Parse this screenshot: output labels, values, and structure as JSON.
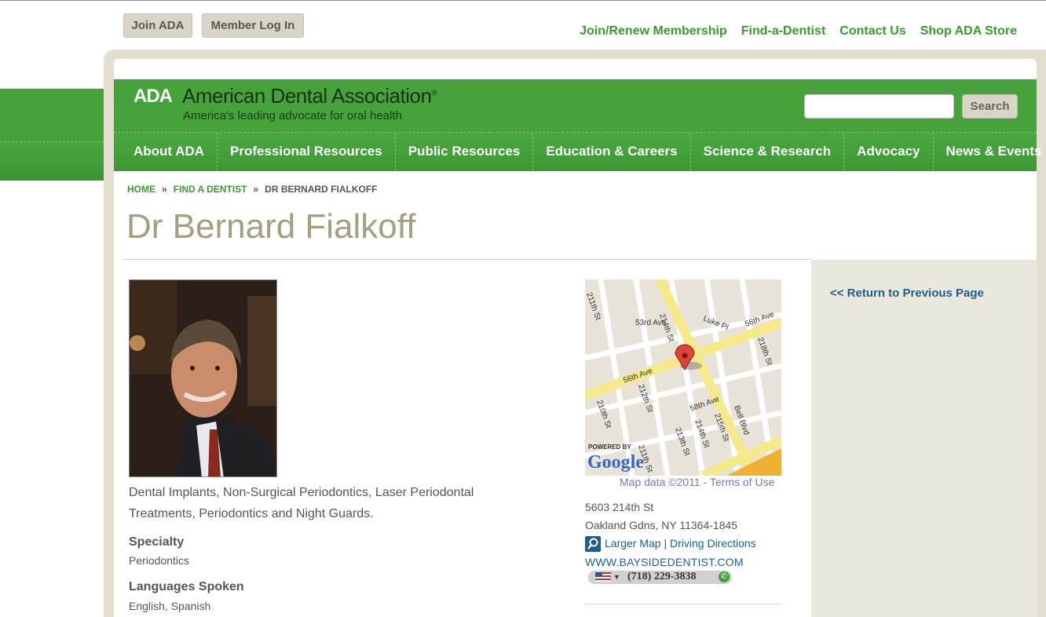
{
  "utility": {
    "join_label": "Join ADA",
    "login_label": "Member Log In"
  },
  "top_links": [
    "Join/Renew Membership",
    "Find-a-Dentist",
    "Contact Us",
    "Shop ADA Store"
  ],
  "header": {
    "logo_abbr": "ADA",
    "org_name": "American Dental Association",
    "org_mark": "®",
    "tagline": "America's leading advocate for oral health",
    "search_placeholder": "",
    "search_label": "Search"
  },
  "nav": [
    "About ADA",
    "Professional Resources",
    "Public Resources",
    "Education & Careers",
    "Science & Research",
    "Advocacy",
    "News & Events"
  ],
  "breadcrumb": {
    "home": "HOME",
    "sep": "»",
    "find": "FIND A DENTIST",
    "current": "DR BERNARD FIALKOFF"
  },
  "profile": {
    "name": "Dr Bernard Fialkoff",
    "description": "Dental Implants, Non-Surgical Periodontics, Laser Periodontal Treatments, Periodontics and Night Guards.",
    "specialty_label": "Specialty",
    "specialty": "Periodontics",
    "languages_label": "Languages Spoken",
    "languages": "English, Spanish"
  },
  "map": {
    "streets": [
      "53rd Ave",
      "214th St",
      "Luke Pl",
      "56th Ave",
      "218th St",
      "211th St",
      "56th Ave",
      "212th St",
      "58th Ave",
      "Bell Blvd",
      "210th St",
      "213th St",
      "214th St",
      "215th St",
      "211th St"
    ],
    "powered_by": "POWERED BY",
    "brand": "Google",
    "credit": "Map data ©2011",
    "credit_sep": "-",
    "terms": "Terms of Use"
  },
  "contact": {
    "address1": "5603 214th St",
    "address2": "Oakland Gdns, NY 11364-1845",
    "map_links": "Larger Map | Driving Directions",
    "website": "WWW.BAYSIDEDENTIST.COM",
    "phone": "(718) 229-3838"
  },
  "sidebar": {
    "return_label": "<< Return to Previous Page"
  },
  "colors": {
    "brand_green": "#46a33c",
    "link_green": "#3a9a32",
    "link_blue": "#1d5f8c",
    "title_tan": "#a59f82",
    "frame_beige": "#e2dfd0"
  }
}
